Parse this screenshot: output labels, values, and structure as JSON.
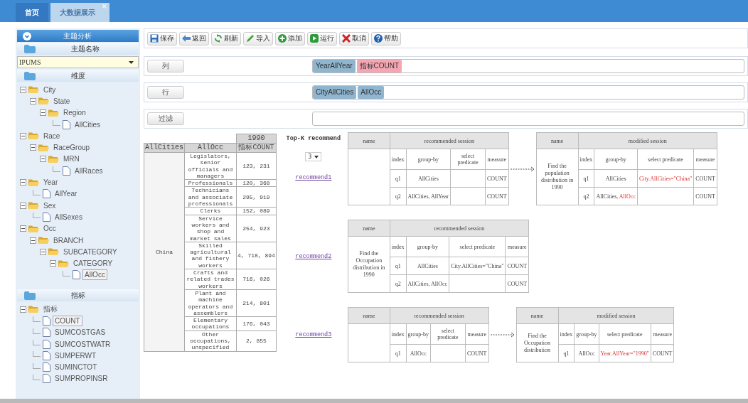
{
  "tabs": [
    {
      "label": "首页",
      "selected": false
    },
    {
      "label": "大数据展示",
      "selected": true,
      "close": "×"
    }
  ],
  "sidebar": {
    "title": "主题分析",
    "subject": {
      "heading": "主题名称",
      "value": "IPUMS"
    },
    "dimensions": {
      "heading": "维度",
      "tree": [
        {
          "label": "City",
          "kind": "folder",
          "expanded": true,
          "selected": false,
          "children": [
            {
              "label": "State",
              "kind": "folder",
              "expanded": true,
              "selected": false,
              "children": [
                {
                  "label": "Region",
                  "kind": "folder",
                  "expanded": true,
                  "selected": false,
                  "children": [
                    {
                      "label": "AllCities",
                      "kind": "file",
                      "selected": false
                    }
                  ]
                }
              ]
            }
          ]
        },
        {
          "label": "Race",
          "kind": "folder",
          "expanded": true,
          "selected": false,
          "children": [
            {
              "label": "RaceGroup",
              "kind": "folder",
              "expanded": true,
              "selected": false,
              "children": [
                {
                  "label": "MRN",
                  "kind": "folder",
                  "expanded": true,
                  "selected": false,
                  "children": [
                    {
                      "label": "AllRaces",
                      "kind": "file",
                      "selected": false
                    }
                  ]
                }
              ]
            }
          ]
        },
        {
          "label": "Year",
          "kind": "folder",
          "expanded": true,
          "selected": false,
          "children": [
            {
              "label": "AllYear",
              "kind": "file",
              "selected": false
            }
          ]
        },
        {
          "label": "Sex",
          "kind": "folder",
          "expanded": true,
          "selected": false,
          "children": [
            {
              "label": "AllSexes",
              "kind": "file",
              "selected": false
            }
          ]
        },
        {
          "label": "Occ",
          "kind": "folder",
          "expanded": true,
          "selected": false,
          "children": [
            {
              "label": "BRANCH",
              "kind": "folder",
              "expanded": true,
              "selected": false,
              "children": [
                {
                  "label": "SUBCATEGORY",
                  "kind": "folder",
                  "expanded": true,
                  "selected": false,
                  "children": [
                    {
                      "label": "CATEGORY",
                      "kind": "folder",
                      "expanded": true,
                      "selected": false,
                      "children": [
                        {
                          "label": "AllOcc",
                          "kind": "file",
                          "selected": true
                        }
                      ]
                    }
                  ]
                }
              ]
            }
          ]
        }
      ]
    },
    "measures": {
      "heading": "指标",
      "tree": [
        {
          "label": "指标",
          "kind": "folder",
          "expanded": true,
          "selected": false,
          "children": [
            {
              "label": "COUNT",
              "kind": "file",
              "selected": true
            },
            {
              "label": "SUMCOSTGAS",
              "kind": "file",
              "selected": false
            },
            {
              "label": "SUMCOSTWATR",
              "kind": "file",
              "selected": false
            },
            {
              "label": "SUMPERWT",
              "kind": "file",
              "selected": false
            },
            {
              "label": "SUMINCTOT",
              "kind": "file",
              "selected": false
            },
            {
              "label": "SUMPROPINSR",
              "kind": "file",
              "selected": false
            }
          ]
        }
      ]
    }
  },
  "toolbar": [
    "保存",
    "返回",
    "刷新",
    "导入",
    "添加",
    "运行",
    "取消",
    "帮助"
  ],
  "shelves": [
    {
      "label": "列",
      "chips": [
        {
          "text": "YearAllYear",
          "color": "#8fb5cf"
        },
        {
          "text": "指标COUNT",
          "color": "#f4a6b3"
        }
      ]
    },
    {
      "label": "行",
      "chips": [
        {
          "text": "CityAllCities",
          "color": "#8fb5cf"
        },
        {
          "text": "AllOcc",
          "color": "#8fb5cf"
        }
      ]
    },
    {
      "label": "过滤"
    }
  ],
  "pivot": {
    "year": "1990",
    "headers": [
      "AllCities",
      "AllOcc",
      "指标COUNT"
    ],
    "city": "China",
    "rows": [
      {
        "occupation": "Legislators, senior officials and managers",
        "count": "123, 231"
      },
      {
        "occupation": "Professionals",
        "count": "120, 368"
      },
      {
        "occupation": "Technicians and associate professionals",
        "count": "295, 919"
      },
      {
        "occupation": "Clerks",
        "count": "152, 089"
      },
      {
        "occupation": "Service workers and shop and market sales",
        "count": "254, 923"
      },
      {
        "occupation": "Skilled agricultural and fishery workers",
        "count": "4, 718, 894"
      },
      {
        "occupation": "Crafts and related trades workers",
        "count": "716, 026"
      },
      {
        "occupation": "Plant and machine operators and assemblers",
        "count": "214, 801"
      },
      {
        "occupation": "Elementary occupations",
        "count": "176, 043"
      },
      {
        "occupation": "Other occupations, unspecified",
        "count": "2, 855"
      }
    ]
  },
  "recommend": {
    "title": "Top-K recommend",
    "k": "3",
    "items": [
      {
        "link": "recommend1",
        "recommended": {
          "name_header": "name",
          "session_header": "recommended session",
          "columns": [
            "index",
            "group-by",
            "select predicate",
            "measure"
          ],
          "rows": [
            {
              "index": "q1",
              "group_by": [
                {
                  "text": "AllCities",
                  "changed": false
                }
              ],
              "measure": "COUNT"
            },
            {
              "index": "q2",
              "group_by": [
                {
                  "text": "AllCities, AllYear",
                  "changed": false
                }
              ],
              "measure": "COUNT"
            }
          ]
        },
        "modified": {
          "name_header": "name",
          "session_header": "modified session",
          "name": "Find the population distribution in 1990",
          "columns": [
            "index",
            "group-by",
            "select predicate",
            "measure"
          ],
          "rows": [
            {
              "index": "q1",
              "group_by": [
                {
                  "text": "AllCities",
                  "changed": false
                }
              ],
              "predicate": [
                {
                  "text": "City.AllCities=\"China\"",
                  "changed": true
                }
              ],
              "measure": "COUNT"
            },
            {
              "index": "q2",
              "group_by": [
                {
                  "text": "AllCities, ",
                  "changed": false
                },
                {
                  "text": "AllOcc",
                  "changed": true
                }
              ],
              "measure": "COUNT"
            }
          ]
        }
      },
      {
        "link": "recommend2",
        "recommended": {
          "name_header": "name",
          "session_header": "recommended session",
          "name": "Find the Occupation distribution in 1990",
          "columns": [
            "index",
            "group-by",
            "select predicate",
            "measure"
          ],
          "rows": [
            {
              "index": "q1",
              "group_by": [
                {
                  "text": "AllCities",
                  "changed": false
                }
              ],
              "predicate": [
                {
                  "text": "City.AllCities=\"China\"",
                  "changed": false
                }
              ],
              "measure": "COUNT"
            },
            {
              "index": "q2",
              "group_by": [
                {
                  "text": "AllCities, AllOcc",
                  "changed": false
                }
              ],
              "measure": "COUNT"
            }
          ]
        }
      },
      {
        "link": "recommend3",
        "recommended": {
          "name_header": "name",
          "session_header": "recommended session",
          "columns": [
            "index",
            "group-by",
            "select predicate",
            "measure"
          ],
          "rows": [
            {
              "index": "q1",
              "group_by": [
                {
                  "text": "AllOcc",
                  "changed": false
                }
              ],
              "measure": "COUNT"
            }
          ]
        },
        "modified": {
          "name_header": "name",
          "session_header": "modified session",
          "name": "Find the Occupation distribution",
          "columns": [
            "index",
            "group-by",
            "select predicate",
            "measure"
          ],
          "rows": [
            {
              "index": "q1",
              "group_by": [
                {
                  "text": "AllOcc",
                  "changed": false
                }
              ],
              "predicate": [
                {
                  "text": "Year.AllYear=\"1990\"",
                  "changed": true
                }
              ],
              "measure": "COUNT"
            }
          ]
        }
      }
    ]
  }
}
